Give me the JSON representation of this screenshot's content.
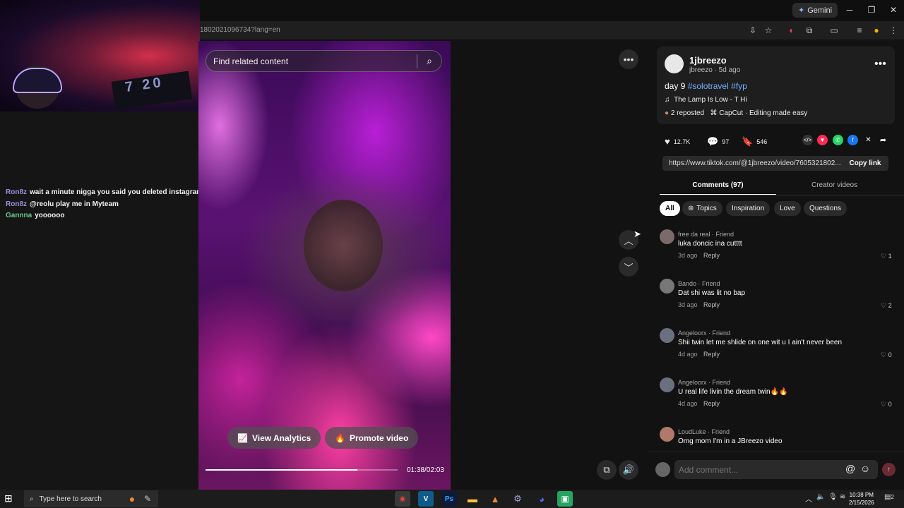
{
  "browser": {
    "gemini_label": "Gemini",
    "url": "1802021096734?lang=en"
  },
  "stream_chat": [
    {
      "user": "Ron8z",
      "message": "wait a minute nigga you said you deleted instagram jackass"
    },
    {
      "user": "Ron8z",
      "message": "@reolu play me in Myteam"
    },
    {
      "user": "Gannna",
      "message": "yoooooo"
    }
  ],
  "webcam_jersey_text": "7 20",
  "video": {
    "search_placeholder": "Find related content",
    "view_analytics_label": "View Analytics",
    "promote_label": "Promote video",
    "time": "01:38/02:03",
    "progress_fraction": 0.79
  },
  "post": {
    "author": "1jbreezo",
    "author_sub": "jbreezo · 5d ago",
    "caption_prefix": "day 9",
    "hashtags": "#solotravel #fyp",
    "music": "The Lamp Is Low - T Hi",
    "reposted": "2 reposted",
    "capcut": "CapCut · Editing made easy",
    "likes": "12.7K",
    "comments_count": "97",
    "saves": "546",
    "link": "https://www.tiktok.com/@1jbreezo/video/7605321802...",
    "copy_link_label": "Copy link"
  },
  "tabs": {
    "comments": "Comments (97)",
    "creator_videos": "Creator videos"
  },
  "chips": [
    "All",
    "Topics",
    "Inspiration",
    "Love",
    "Questions"
  ],
  "comments": [
    {
      "name": "free da real · Friend",
      "text": "luka doncic ina cutttt",
      "age": "3d ago",
      "reply": "Reply",
      "likes": "1"
    },
    {
      "name": "Bando · Friend",
      "text": "Dat shi was lit no bap",
      "age": "3d ago",
      "reply": "Reply",
      "likes": "2"
    },
    {
      "name": "Angeloorx · Friend",
      "text": "Shii twin let me shlide on one wit u I ain't never been",
      "age": "4d ago",
      "reply": "Reply",
      "likes": "0"
    },
    {
      "name": "Angeloorx · Friend",
      "text": "U real life livin the dream twin🔥🔥",
      "age": "4d ago",
      "reply": "Reply",
      "likes": "0"
    },
    {
      "name": "LoudLuke · Friend",
      "text": "Omg mom I'm in a JBreezo video",
      "age": "",
      "reply": "",
      "likes": ""
    }
  ],
  "comment_input": {
    "placeholder": "Add comment..."
  },
  "taskbar": {
    "search_placeholder": "Type here to search",
    "time": "10:38 PM",
    "date": "2/15/2026",
    "notification_count": "2"
  }
}
